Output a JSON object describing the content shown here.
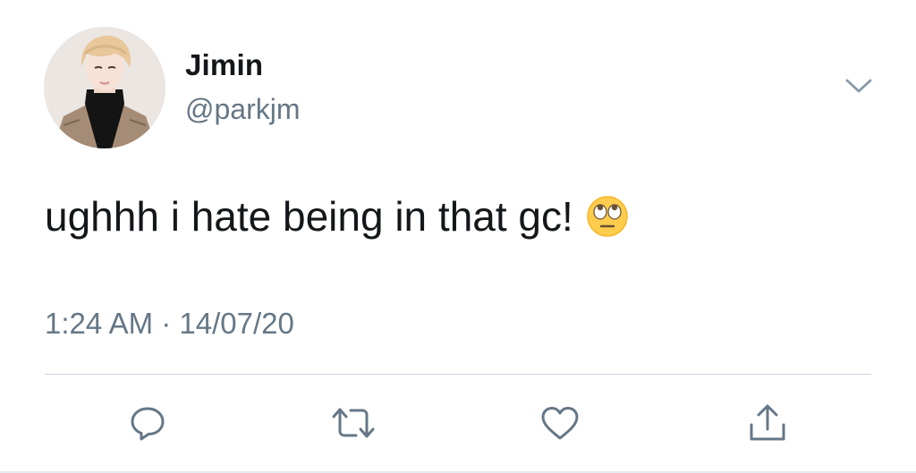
{
  "tweet": {
    "author_name": "Jimin",
    "author_handle": "@parkjm",
    "text": "ughhh i hate being in that gc!",
    "emoji_icon": "face-with-rolling-eyes-icon",
    "timestamp": "1:24 AM · 14/07/20"
  },
  "actions": [
    {
      "name": "reply",
      "icon": "speech-bubble-icon"
    },
    {
      "name": "retweet",
      "icon": "retweet-arrows-icon"
    },
    {
      "name": "like",
      "icon": "heart-icon"
    },
    {
      "name": "share",
      "icon": "share-upload-icon"
    }
  ],
  "colors": {
    "text_primary": "#14171a",
    "text_secondary": "#657786",
    "divider": "#ccd6dd"
  }
}
